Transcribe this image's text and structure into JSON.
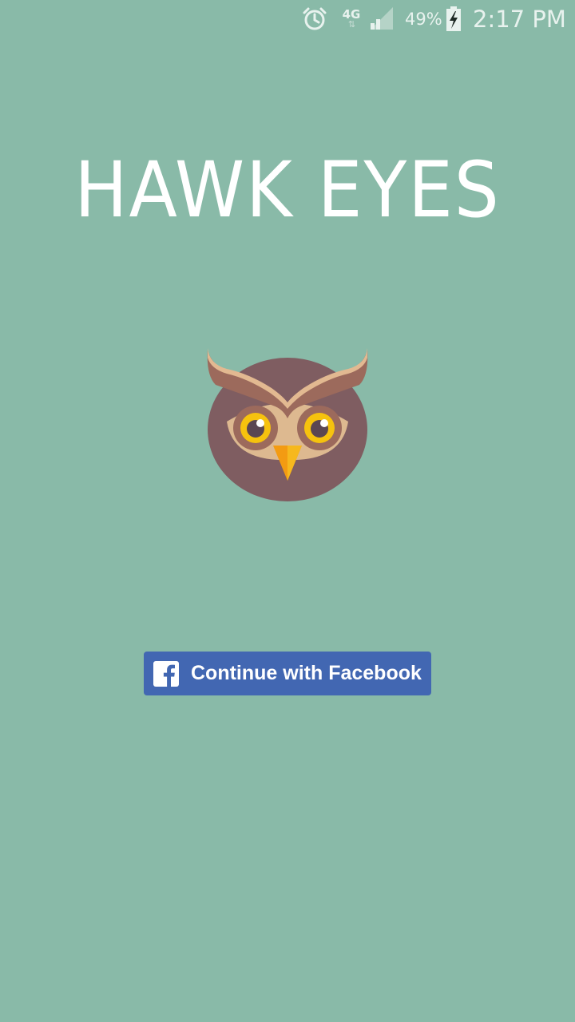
{
  "status_bar": {
    "network_type": "4G",
    "network_activity": "⇅",
    "battery_percent": "49%",
    "time": "2:17 PM",
    "icons": [
      "alarm-icon",
      "signal-icon",
      "battery-charging-icon"
    ]
  },
  "title": "HAWK EYES",
  "logo_icon": "owl-icon",
  "facebook_button": {
    "label": "Continue with Facebook",
    "icon": "facebook-icon"
  },
  "colors": {
    "background": "#89BAA8",
    "facebook_blue": "#4267B2",
    "title_text": "#FFFFFF"
  }
}
